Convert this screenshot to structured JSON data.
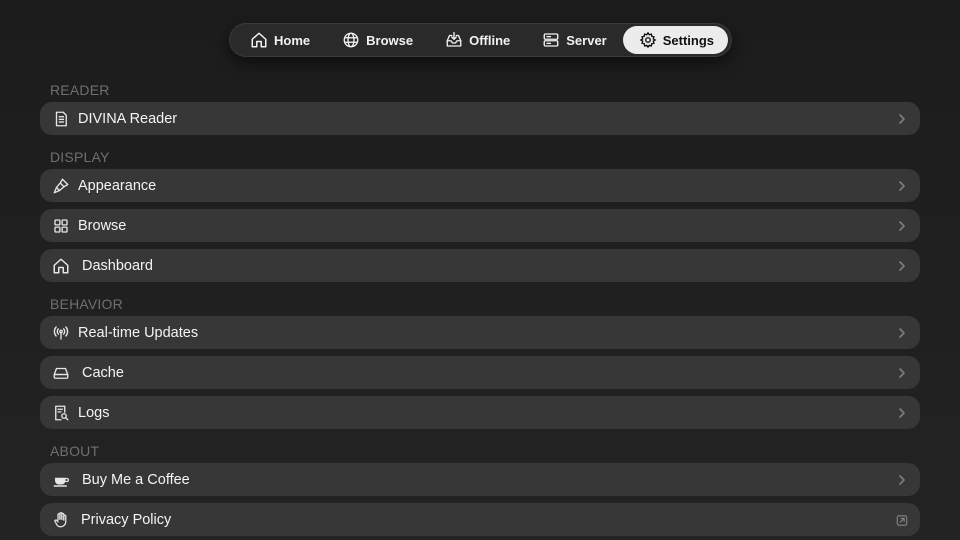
{
  "tabs": [
    {
      "label": "Home",
      "icon": "home-icon",
      "active": false
    },
    {
      "label": "Browse",
      "icon": "globe-icon",
      "active": false
    },
    {
      "label": "Offline",
      "icon": "download-tray-icon",
      "active": false
    },
    {
      "label": "Server",
      "icon": "server-icon",
      "active": false
    },
    {
      "label": "Settings",
      "icon": "gear-icon",
      "active": true
    }
  ],
  "sections": {
    "reader": {
      "header": "READER",
      "items": [
        {
          "label": "DIVINA Reader",
          "icon": "document-icon"
        }
      ]
    },
    "display": {
      "header": "DISPLAY",
      "items": [
        {
          "label": "Appearance",
          "icon": "paintbrush-icon"
        },
        {
          "label": "Browse",
          "icon": "grid-icon"
        },
        {
          "label": "Dashboard",
          "icon": "home-icon"
        }
      ]
    },
    "behavior": {
      "header": "BEHAVIOR",
      "items": [
        {
          "label": "Real-time Updates",
          "icon": "antenna-icon"
        },
        {
          "label": "Cache",
          "icon": "drive-icon"
        },
        {
          "label": "Logs",
          "icon": "log-search-icon"
        }
      ]
    },
    "about": {
      "header": "ABOUT",
      "items": [
        {
          "label": "Buy Me a Coffee",
          "icon": "coffee-cup-icon"
        },
        {
          "label": "Privacy Policy",
          "icon": "hand-icon"
        }
      ]
    }
  },
  "colors": {
    "background": "#1e1e1e",
    "row_background": "#373737",
    "section_header": "#6f6f6f",
    "active_tab": "#ececec"
  }
}
